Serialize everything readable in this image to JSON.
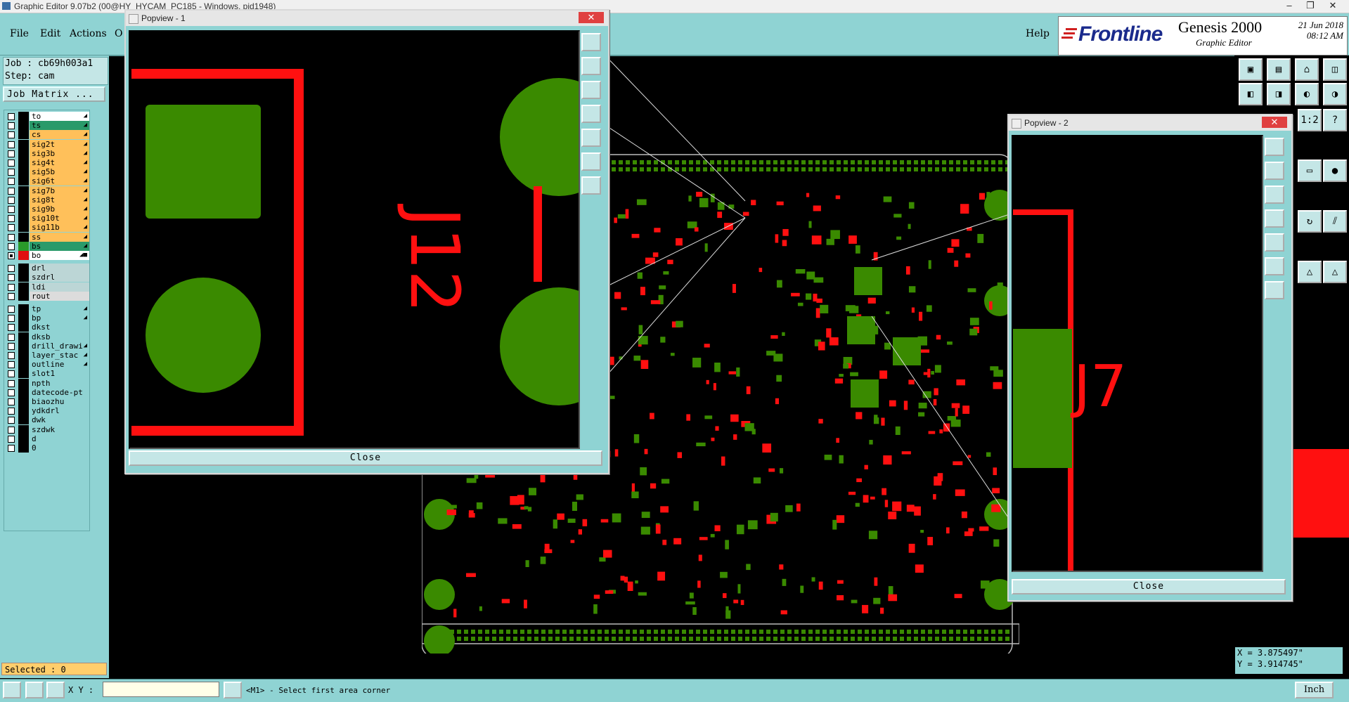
{
  "window": {
    "title": "Graphic Editor 9.07b2 (00@HY_HYCAM_PC185 - Windows, pid1948)",
    "min": "–",
    "max": "❐",
    "close": "✕"
  },
  "menu": {
    "file": "File",
    "edit": "Edit",
    "actions": "Actions",
    "options": "O",
    "help": "Help"
  },
  "brand": {
    "logo": "Frontline",
    "product": "Genesis 2000",
    "subtitle": "Graphic Editor",
    "date": "21 Jun 2018",
    "time": "08:12 AM"
  },
  "job": {
    "job": "Job : cb69h003a1",
    "step": "Step: cam",
    "matrix_button": "Job Matrix ..."
  },
  "layers": [
    {
      "name": "to",
      "color": "#ffffff",
      "arrow": "◢",
      "checked": false,
      "swatch": "#000000"
    },
    {
      "name": "ts",
      "color": "#2a9a6a",
      "arrow": "◢",
      "checked": false,
      "swatch": "#000000"
    },
    {
      "name": "cs",
      "color": "#ffc05a",
      "arrow": "◢",
      "checked": false,
      "swatch": "#000000"
    },
    {
      "name": "sig2t",
      "color": "#ffc05a",
      "arrow": "◢",
      "checked": false,
      "swatch": "#000000"
    },
    {
      "name": "sig3b",
      "color": "#ffc05a",
      "arrow": "◢",
      "checked": false,
      "swatch": "#000000"
    },
    {
      "name": "sig4t",
      "color": "#ffc05a",
      "arrow": "◢",
      "checked": false,
      "swatch": "#000000"
    },
    {
      "name": "sig5b",
      "color": "#ffc05a",
      "arrow": "◢",
      "checked": false,
      "swatch": "#000000"
    },
    {
      "name": "sig6t",
      "color": "#ffc05a",
      "arrow": "◢",
      "checked": false,
      "swatch": "#000000"
    },
    {
      "name": "sig7b",
      "color": "#ffc05a",
      "arrow": "◢",
      "checked": false,
      "swatch": "#000000"
    },
    {
      "name": "sig8t",
      "color": "#ffc05a",
      "arrow": "◢",
      "checked": false,
      "swatch": "#000000"
    },
    {
      "name": "sig9b",
      "color": "#ffc05a",
      "arrow": "◢",
      "checked": false,
      "swatch": "#000000"
    },
    {
      "name": "sig10t",
      "color": "#ffc05a",
      "arrow": "◢",
      "checked": false,
      "swatch": "#000000"
    },
    {
      "name": "sig11b",
      "color": "#ffc05a",
      "arrow": "◢",
      "checked": false,
      "swatch": "#000000"
    },
    {
      "name": "ss",
      "color": "#ffc05a",
      "arrow": "◢",
      "checked": false,
      "swatch": "#000000"
    },
    {
      "name": "bs",
      "color": "#2a9a6a",
      "arrow": "◢",
      "checked": false,
      "swatch": "#2a9a2a"
    },
    {
      "name": "bo",
      "color": "#ffffff",
      "arrow": "◢■",
      "checked": true,
      "swatch": "#e01010"
    },
    {
      "name": "drl",
      "color": "#bcd6d6",
      "arrow": "",
      "checked": false,
      "swatch": "#000000"
    },
    {
      "name": "szdrl",
      "color": "#bcd6d6",
      "arrow": "",
      "checked": false,
      "swatch": "#000000"
    },
    {
      "name": "ldi",
      "color": "#bcd6d6",
      "arrow": "",
      "checked": false,
      "swatch": "#000000"
    },
    {
      "name": "rout",
      "color": "#dcdcdc",
      "arrow": "",
      "checked": false,
      "swatch": "#000000"
    },
    {
      "name": "tp",
      "color": "#8fd3d3",
      "arrow": "◢",
      "checked": false,
      "swatch": "#000000"
    },
    {
      "name": "bp",
      "color": "#8fd3d3",
      "arrow": "◢",
      "checked": false,
      "swatch": "#000000"
    },
    {
      "name": "dkst",
      "color": "#8fd3d3",
      "arrow": "",
      "checked": false,
      "swatch": "#000000"
    },
    {
      "name": "dksb",
      "color": "#8fd3d3",
      "arrow": "",
      "checked": false,
      "swatch": "#000000"
    },
    {
      "name": "drill_drawi",
      "color": "#8fd3d3",
      "arrow": "◢",
      "checked": false,
      "swatch": "#000000"
    },
    {
      "name": "layer_stac",
      "color": "#8fd3d3",
      "arrow": "◢",
      "checked": false,
      "swatch": "#000000"
    },
    {
      "name": "outline",
      "color": "#8fd3d3",
      "arrow": "◢",
      "checked": false,
      "swatch": "#000000"
    },
    {
      "name": "slot1",
      "color": "#8fd3d3",
      "arrow": "",
      "checked": false,
      "swatch": "#000000"
    },
    {
      "name": "npth",
      "color": "#8fd3d3",
      "arrow": "",
      "checked": false,
      "swatch": "#000000"
    },
    {
      "name": "datecode-pt",
      "color": "#8fd3d3",
      "arrow": "",
      "checked": false,
      "swatch": "#000000"
    },
    {
      "name": "biaozhu",
      "color": "#8fd3d3",
      "arrow": "",
      "checked": false,
      "swatch": "#000000"
    },
    {
      "name": "ydkdrl",
      "color": "#8fd3d3",
      "arrow": "",
      "checked": false,
      "swatch": "#000000"
    },
    {
      "name": "dwk",
      "color": "#8fd3d3",
      "arrow": "",
      "checked": false,
      "swatch": "#000000"
    },
    {
      "name": "szdwk",
      "color": "#8fd3d3",
      "arrow": "",
      "checked": false,
      "swatch": "#000000"
    },
    {
      "name": "d",
      "color": "#8fd3d3",
      "arrow": "",
      "checked": false,
      "swatch": "#000000"
    },
    {
      "name": "0",
      "color": "#8fd3d3",
      "arrow": "",
      "checked": false,
      "swatch": "#000000"
    }
  ],
  "selected": "Selected : 0",
  "status": {
    "xy_label": "X Y :",
    "xy_value": "",
    "message": "<M1> - Select first area corner",
    "unit": "Inch"
  },
  "coords": {
    "x": "X = 3.875497\"",
    "y": "Y = 3.914745\""
  },
  "popview1": {
    "title": "Popview - 1",
    "close": "Close",
    "label": "J12"
  },
  "popview2": {
    "title": "Popview - 2",
    "close": "Close",
    "label": "J7"
  },
  "colors": {
    "copper": "#3a8a00",
    "silk": "#ff1010",
    "panel": "#8fd3d3",
    "outline": "#bcbcbc"
  }
}
